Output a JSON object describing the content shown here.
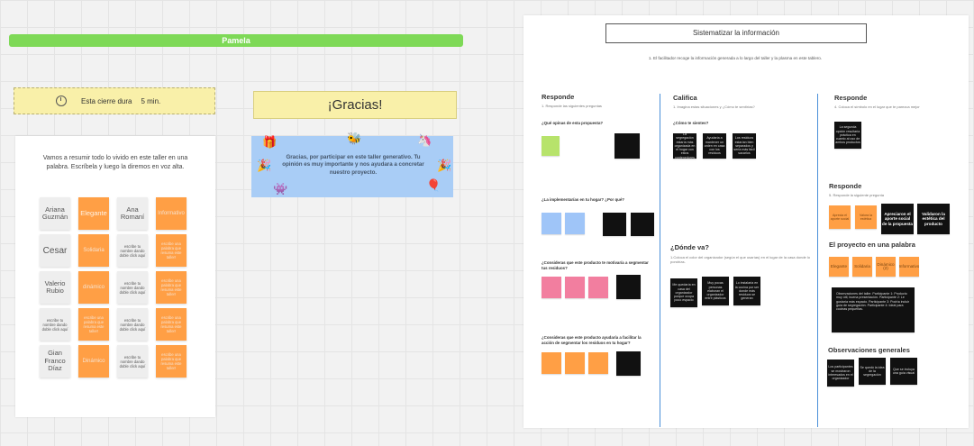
{
  "frame_left": {
    "title": "Pamela",
    "timer": {
      "label": "Esta cierre dura",
      "value": "5 min."
    },
    "instructions": "Vamos a resumir todo lo vivido en este taller en una palabra. Escríbela y luego la diremos en voz alta.",
    "notes": [
      [
        "Ariana Guzmán",
        "Elegante",
        "Ana Romaní",
        "Informativo"
      ],
      [
        "Cesar",
        "Solidaria",
        "escribe tu nombre dando doble click aquí",
        "escribe una palabra que resuma este taller!"
      ],
      [
        "Valerio Rubio",
        "dinámico",
        "escribe tu nombre dando doble click aquí",
        "escribe una palabra que resuma este taller!"
      ],
      [
        "escribe tu nombre dando doble click aquí",
        "escribe una palabra que resuma este taller!",
        "escribe tu nombre dando doble click aquí",
        "escribe una palabra que resuma este taller!"
      ],
      [
        "Gian Franco Díaz",
        "Dinámico",
        "escribe tu nombre dando doble click aquí",
        "escribe una palabra que resuma este taller!"
      ]
    ]
  },
  "gracias": {
    "title": "¡Gracias!",
    "message": "Gracias, por participar en este taller generativo. Tu opinión es muy importante y nos ayudara a concretar nuestro proyecto."
  },
  "sistematizar": {
    "title": "Sistematizar la información",
    "subtitle": "1. El facilitador recoge la información generada a lo largo del taller y la plasma en este tablero.",
    "col1": {
      "heading": "Responde",
      "sub": "1. Responde las siguientes preguntas",
      "q1": "¿Qué opinas de esta propuesta?",
      "q2": "¿La implementarías en tu hogar? ¿Por qué?",
      "q3": "¿Consideras que este producto te motivaría a segmentar tus residuos?",
      "q4": "¿Consideras que este producto ayudaría a facilitar la acción de segmentar los residuos en tu hogar?"
    },
    "col2": {
      "heading": "Califica",
      "sub": "1. Imagina estas situaciones y ¿Cómo te sentirías?",
      "q1": "¿Cómo te sientes?",
      "heading2": "¿Dónde va?",
      "sub2": "1.Coloca el color del organizador (según el que usarías) en el lugar de la casa donde lo pondrías.",
      "notes1": [
        "La segregación estaría más organizada en el hogar con estos contenedores",
        "Ayudaría a mantener un orden en casa con los residuos",
        "Los residuos estarían bien separados y sería más fácil sacarlos"
      ],
      "notes2": [
        "Me quedaría en casa del organizador porque ocupa poco espacio",
        "Muy pocas personas elaboran el organizador entre plásticos",
        "Lo instalaría en la cocina por ser donde más residuos se generan"
      ]
    },
    "col3": {
      "heading": "Responde",
      "sub": "4. Coloca el símbolo en el lugar que te parezca mejor",
      "note1": "La segunda opción resultaría práctica en cuanto al uso de ambos productos",
      "heading2": "Responde",
      "sub2": "5. Responde la siguiente pregunta",
      "notes2": [
        "Aprecia el aporte social",
        "Valora la estética",
        "Apreciaron el aporte social de la propuesta",
        "Validaron la estética del producto"
      ],
      "heading3": "El proyecto en una palabra",
      "words": [
        "Elegante",
        "Solidaria",
        "Dinámico (2)",
        "Informativo"
      ],
      "box_text": "Observaciones del taller. Participante 1: Producto muy útil, buena presentación. Participante 2: Le gustaría más espacio. Participante 3: Podría incluir guía de segregación. Participante 4: Ideal para cocinas pequeñas.",
      "heading4": "Observaciones generales",
      "obs": [
        "Los participantes se mostraron interesados en el organizador",
        "Se quedó la idea de la segregación",
        "Que se incluya una guía visual"
      ]
    }
  },
  "colors": {
    "green": "#7ed957",
    "yellow": "#f9f0a9",
    "orange": "#ff9f45",
    "blue_card": "#a9cdf6",
    "divider": "#4a90d9"
  }
}
